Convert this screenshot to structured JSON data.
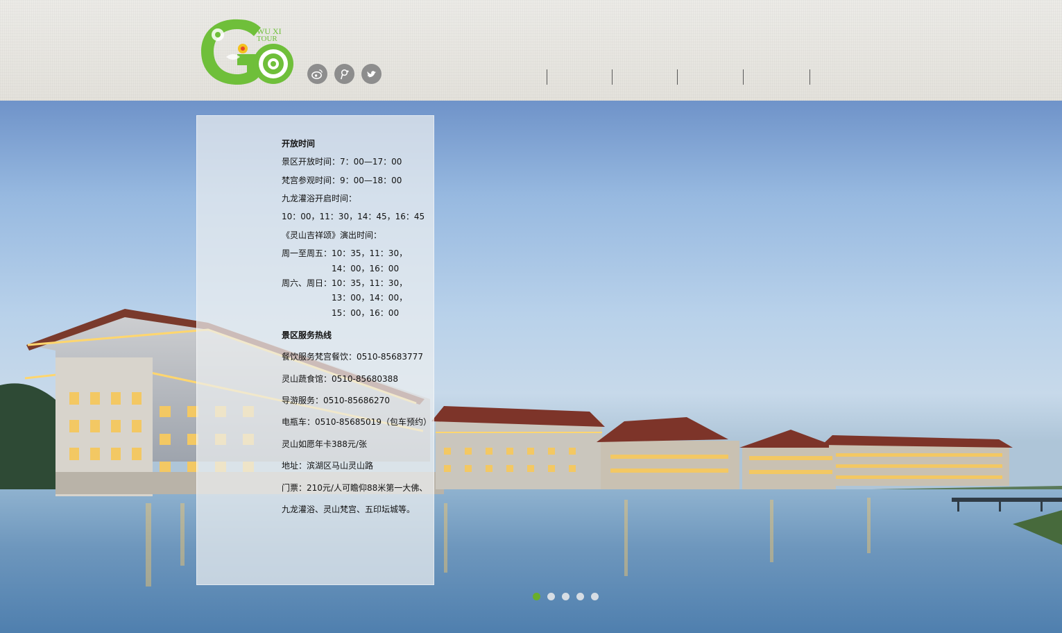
{
  "logo": {
    "text_line1": "WU XI",
    "text_line2": "TOUR",
    "letters": "GO"
  },
  "social": [
    {
      "name": "weibo-icon"
    },
    {
      "name": "tencent-weibo-icon"
    },
    {
      "name": "twitter-icon"
    }
  ],
  "nav": {
    "items": [
      "",
      "",
      "",
      ""
    ]
  },
  "colors": {
    "accent": "#6aae2a",
    "logo_green": "#6fbf3a",
    "social_bg": "#8d8d8d"
  },
  "panel": {
    "hours_title": "开放时间",
    "line1": "景区开放时间：7：00—17：00",
    "line2": "梵宫参观时间：9：00—18：00",
    "line3": "九龙灌浴开启时间：",
    "line4": "10：00，11：30，14：45，16：45",
    "line5": "《灵山吉祥颂》演出时间：",
    "line6": "周一至周五：10：35，11：30，",
    "line7": "14：00，16：00",
    "line8": "周六、周日：10：35，11：30，",
    "line9": "13：00，14：00，",
    "line10": "15：00，16：00",
    "service_title": "景区服务热线",
    "s1": "餐饮服务梵宫餐饮：0510-85683777",
    "s2": "灵山蔬食馆：0510-85680388",
    "s3": "导游服务：0510-85686270",
    "s4": "电瓶车：0510-85685019（包车预约）",
    "s5": "灵山如愿年卡388元/张",
    "s6": "地址：滨湖区马山灵山路",
    "s7": "门票：210元/人可瞻仰88米第一大佛、",
    "s8": "九龙灌浴、灵山梵宫、五印坛城等。"
  },
  "slider": {
    "count": 5,
    "active_index": 0
  }
}
